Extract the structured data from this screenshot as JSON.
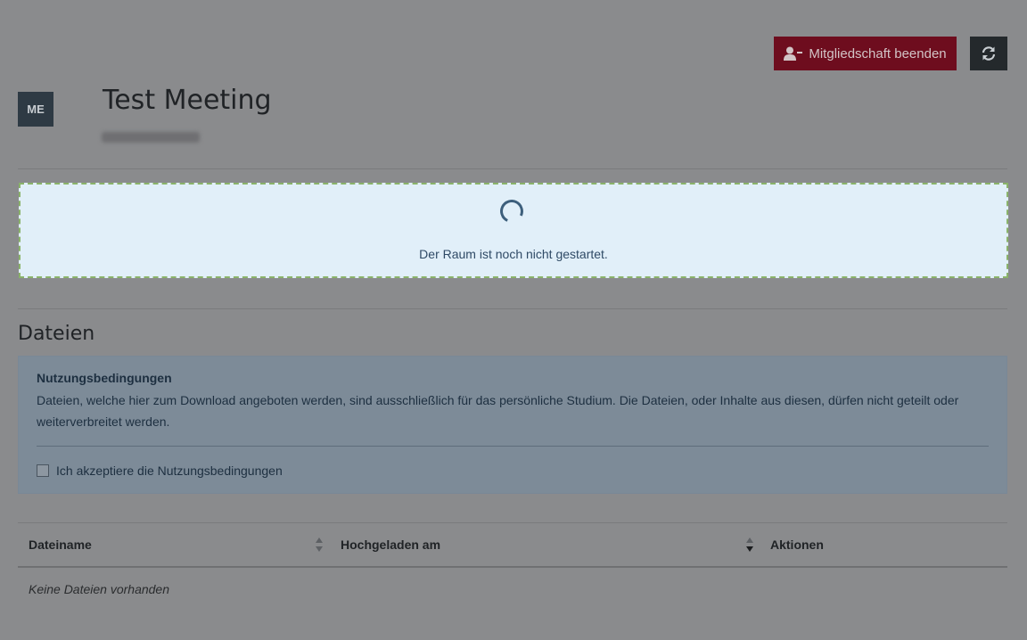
{
  "header": {
    "leave_label": "Mitgliedschaft beenden",
    "avatar_initials": "ME",
    "room_title": "Test Meeting"
  },
  "status": {
    "message": "Der Raum ist noch nicht gestartet."
  },
  "files": {
    "section_title": "Dateien",
    "terms": {
      "title": "Nutzungsbedingungen",
      "text": "Dateien, welche hier zum Download angeboten werden, sind ausschließlich für das persönliche Studium. Die Dateien, oder Inhalte aus diesen, dürfen nicht geteilt oder weiterverbreitet werden.",
      "accept_label": "Ich akzeptiere die Nutzungsbedingungen",
      "accepted": false
    },
    "table": {
      "columns": [
        "Dateiname",
        "Hochgeladen am",
        "Aktionen"
      ],
      "empty_message": "Keine Dateien vorhanden"
    }
  },
  "colors": {
    "leave_button": "#6e0d1e",
    "status_background": "#e1eff9",
    "status_border": "#8ab36a"
  },
  "icons": {
    "leave": "user-minus-icon",
    "refresh": "refresh-icon",
    "spinner": "loading-spinner-icon"
  }
}
